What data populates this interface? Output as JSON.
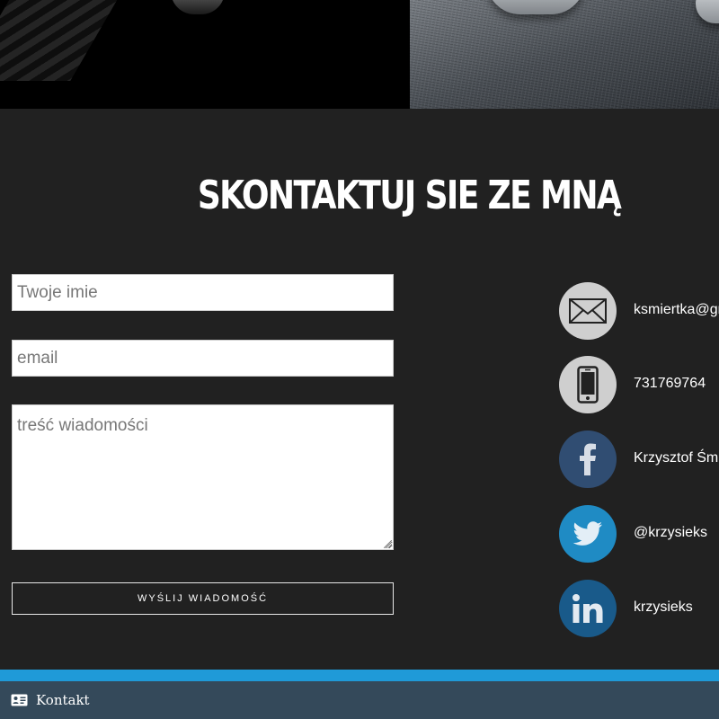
{
  "contact_section": {
    "heading": "SKONTAKTUJ SIE ZE MNĄ"
  },
  "form": {
    "name_placeholder": "Twoje imie",
    "email_placeholder": "email",
    "message_placeholder": "treść wiadomości",
    "send_label": "WYŚLIJ WIADOMOŚĆ"
  },
  "contacts": {
    "email": {
      "text": "ksmiertka@gm",
      "icon": "envelope-icon",
      "color": "#cfcfcf"
    },
    "phone": {
      "text": "731769764",
      "icon": "smartphone-icon",
      "color": "#cfcfcf"
    },
    "facebook": {
      "text": "Krzysztof Śmie",
      "icon": "facebook-icon",
      "color": "#304d72"
    },
    "twitter": {
      "text": "@krzysieks",
      "icon": "twitter-icon",
      "color": "#1f8bc4"
    },
    "linkedin": {
      "text": "krzysieks",
      "icon": "linkedin-icon",
      "color": "#195a8a"
    }
  },
  "bottom_bar": {
    "tab_label": "Kontakt",
    "tab_icon": "id-card-icon",
    "accent_color": "#1f9ad8",
    "bar_color": "#34495a"
  }
}
